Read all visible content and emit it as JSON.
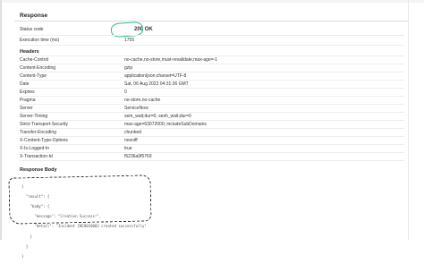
{
  "response": {
    "title": "Response",
    "status": {
      "label": "Status code",
      "value": "200 OK"
    },
    "exec_time": {
      "label": "Execution time (ms)",
      "value": "1755"
    }
  },
  "headers": {
    "title": "Headers",
    "rows": [
      {
        "key": "Cache-Control",
        "value": "no-cache,no-store,must-revalidate,max-age=-1"
      },
      {
        "key": "Content-Encoding",
        "value": "gzip"
      },
      {
        "key": "Content-Type",
        "value": "application/json;charset=UTF-8"
      },
      {
        "key": "Date",
        "value": "Sat, 06 Aug 2022 04:31:36 GMT"
      },
      {
        "key": "Expires",
        "value": "0"
      },
      {
        "key": "Pragma",
        "value": "no-store,no-cache"
      },
      {
        "key": "Server",
        "value": "ServiceNow"
      },
      {
        "key": "Server-Timing",
        "value": "sem_wait;dur=0, sesh_wait;dur=0"
      },
      {
        "key": "Strict-Transport-Security",
        "value": "max-age=63072000; includeSubDomains"
      },
      {
        "key": "Transfer-Encoding",
        "value": "chunked"
      },
      {
        "key": "X-Content-Type-Options",
        "value": "nosniff"
      },
      {
        "key": "X-Is-Logged-In",
        "value": "true"
      },
      {
        "key": "X-Transaction-Id",
        "value": "f5236a9f5769"
      }
    ]
  },
  "body": {
    "title": "Response Body",
    "lines": [
      "{",
      "  \"result\": {",
      "    \"body\": {",
      "      \"message\": \"Creation Success!\",",
      "      \"detail\": \"Incident INC0010003 created successfully\"",
      "    }",
      "  }",
      "}"
    ]
  },
  "colors": {
    "status_ok": "#3a9a5a",
    "annotation_ring": "#2dbb8b"
  }
}
